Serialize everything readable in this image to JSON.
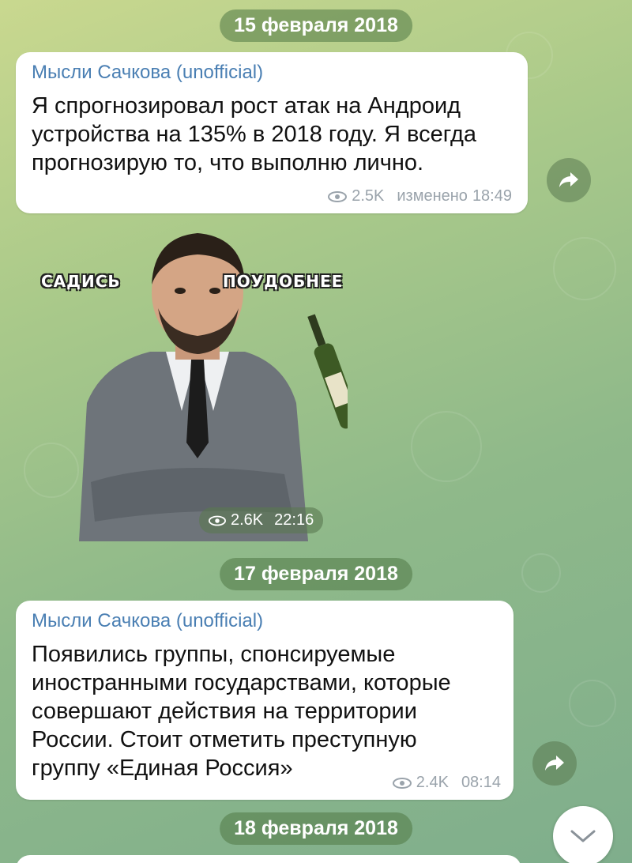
{
  "dates": [
    "15 февраля 2018",
    "17 февраля 2018",
    "18 февраля 2018"
  ],
  "messages": [
    {
      "author": "Мысли Сачкова (unofficial)",
      "text": "Я спрогнозировал рост атак на Андроид устройства на 135% в 2018 году. Я всегда прогнозирую то, что выполню лично.",
      "views": "2.5K",
      "edited": "изменено",
      "time": "18:49"
    },
    {
      "author": "Мысли Сачкова (unofficial)",
      "text": "Появились группы, спонсируемые иностранными государствами, которые совершают действия на территории России. Стоит отметить преступную группу «Единая Россия»",
      "views": "2.4K",
      "time": "08:14"
    }
  ],
  "sticker": {
    "label_left": "САДИСЬ",
    "label_right": "ПОУДОБНЕЕ",
    "views": "2.6K",
    "time": "22:16"
  },
  "icons": {
    "views": "eye-icon",
    "forward": "share-arrow-icon",
    "scroll": "chevron-down-icon"
  },
  "colors": {
    "author": "#4a7fb3",
    "date_pill": "#5a7a4a"
  }
}
